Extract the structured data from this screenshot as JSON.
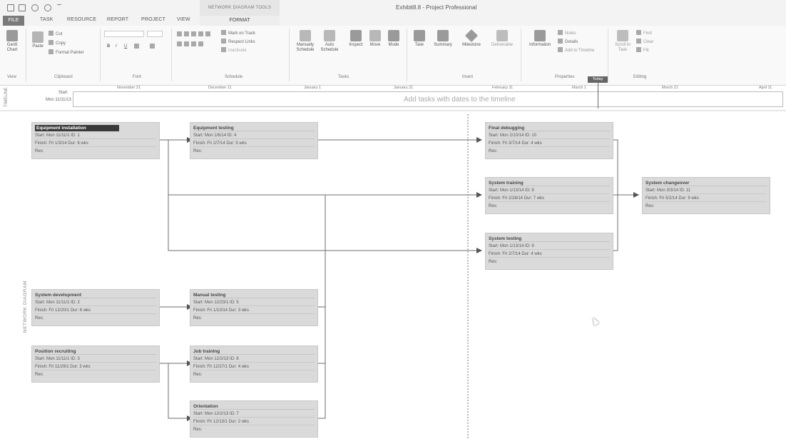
{
  "window": {
    "title": "Exhibit8.8 - Project Professional",
    "contextual_group": "NETWORK DIAGRAM TOOLS"
  },
  "tabs": [
    "FILE",
    "TASK",
    "RESOURCE",
    "REPORT",
    "PROJECT",
    "VIEW",
    "FORMAT"
  ],
  "ribbon": {
    "groups": [
      "View",
      "Clipboard",
      "Font",
      "Schedule",
      "Tasks",
      "Insert",
      "Properties",
      "Editing"
    ],
    "view": {
      "gantt": "Gantt Chart"
    },
    "clipboard": {
      "paste": "Paste",
      "cut": "Cut",
      "copy": "Copy",
      "format_painter": "Format Painter"
    },
    "font": {
      "bold": "B",
      "italic": "I",
      "underline": "U"
    },
    "schedule": {
      "mark_on_track": "Mark on Track",
      "respect_links": "Respect Links",
      "inactivate": "Inactivate"
    },
    "tasks": {
      "manually": "Manually Schedule",
      "auto": "Auto Schedule",
      "inspect": "Inspect",
      "move": "Move",
      "mode": "Mode"
    },
    "insert": {
      "task": "Task",
      "summary": "Summary",
      "milestone": "Milestone",
      "deliverable": "Deliverable"
    },
    "properties": {
      "information": "Information",
      "notes": "Notes",
      "details": "Details",
      "add_to_timeline": "Add to Timeline"
    },
    "editing": {
      "scroll_to_task": "Scroll to Task",
      "find": "Find",
      "clear": "Clear",
      "fill": "Fill"
    }
  },
  "timeline": {
    "side_label": "TIMELINE",
    "start_label": "Start",
    "start_date": "Mon 11/11/13",
    "dates": [
      "November 21",
      "December 11",
      "January 1",
      "January 21",
      "February 11",
      "March 1",
      "March 21",
      "April 11"
    ],
    "placeholder": "Add tasks with dates to the timeline",
    "today": "Today"
  },
  "network": {
    "side_label": "NETWORK DIAGRAM",
    "tasks": [
      {
        "name": "Equipment installation",
        "start": "Start: Mon 11/11/1 ID: 1",
        "finish": "Finish: Fri 1/3/14   Dur: 8 wks",
        "res": "Res:"
      },
      {
        "name": "Equipment testing",
        "start": "Start: Mon 1/6/14  ID: 4",
        "finish": "Finish: Fri 2/7/14   Dur: 5 wks",
        "res": "Res:"
      },
      {
        "name": "Final debugging",
        "start": "Start: Mon 2/10/14 ID: 10",
        "finish": "Finish: Fri 3/7/14   Dur: 4 wks",
        "res": "Res:"
      },
      {
        "name": "System training",
        "start": "Start: Mon 1/13/14 ID: 8",
        "finish": "Finish: Fri 2/28/14  Dur: 7 wks",
        "res": "Res:"
      },
      {
        "name": "System changeover",
        "start": "Start: Mon 3/3/14   ID: 11",
        "finish": "Finish: Fri 5/2/14   Dur: 9 wks",
        "res": "Res:"
      },
      {
        "name": "System testing",
        "start": "Start: Mon 1/13/14 ID: 9",
        "finish": "Finish: Fri 2/7/14   Dur: 4 wks",
        "res": "Res:"
      },
      {
        "name": "System development",
        "start": "Start: Mon 11/11/1 ID: 2",
        "finish": "Finish: Fri 12/20/1 Dur: 6 wks",
        "res": "Res:"
      },
      {
        "name": "Manual testing",
        "start": "Start: Mon 12/23/1 ID: 5",
        "finish": "Finish: Fri 1/10/14  Dur: 3 wks",
        "res": "Res:"
      },
      {
        "name": "Position recruiting",
        "start": "Start: Mon 11/11/1 ID: 3",
        "finish": "Finish: Fri 11/29/1 Dur: 3 wks",
        "res": "Res:"
      },
      {
        "name": "Job training",
        "start": "Start: Mon 12/2/13 ID: 6",
        "finish": "Finish: Fri 12/27/1 Dur: 4 wks",
        "res": "Res:"
      },
      {
        "name": "Orientation",
        "start": "Start: Mon 12/2/13 ID: 7",
        "finish": "Finish: Fri 12/13/1 Dur: 2 wks",
        "res": "Res:"
      }
    ]
  }
}
